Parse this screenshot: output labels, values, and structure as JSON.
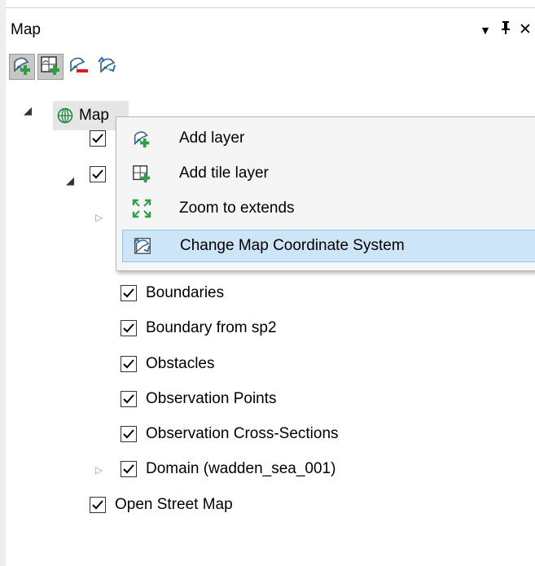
{
  "panel": {
    "title": "Map",
    "dropdown_icon": "▼",
    "pin_icon": "ᛘ",
    "close_icon": "✕"
  },
  "toolbar": {
    "buttons": [
      {
        "icon": "add-layer-icon",
        "active": true
      },
      {
        "icon": "add-tile-layer-icon",
        "active": true
      },
      {
        "icon": "remove-layer-icon",
        "active": false
      },
      {
        "icon": "change-coordinate-system-icon",
        "active": false
      }
    ]
  },
  "tree": {
    "root_label": "Map",
    "items": [
      {
        "label": "Boundaries",
        "checked": true
      },
      {
        "label": "Boundary from sp2",
        "checked": true
      },
      {
        "label": "Obstacles",
        "checked": true
      },
      {
        "label": "Observation Points",
        "checked": true
      },
      {
        "label": "Observation Cross-Sections",
        "checked": true
      },
      {
        "label": "Domain (wadden_sea_001)",
        "checked": true
      },
      {
        "label": "Open Street Map",
        "checked": true
      }
    ]
  },
  "context_menu": {
    "items": [
      {
        "label": "Add layer",
        "icon": "add-layer-icon"
      },
      {
        "label": "Add tile layer",
        "icon": "add-tile-layer-icon"
      },
      {
        "label": "Zoom to extends",
        "icon": "zoom-extents-icon"
      },
      {
        "label": "Change Map Coordinate System",
        "icon": "change-coordinate-system-icon",
        "highlighted": true
      }
    ]
  },
  "colors": {
    "accent_green": "#2ea043",
    "highlight_bg": "#cde6f7",
    "highlight_border": "#8fc6eb",
    "globe_green": "#1f8a3a"
  }
}
